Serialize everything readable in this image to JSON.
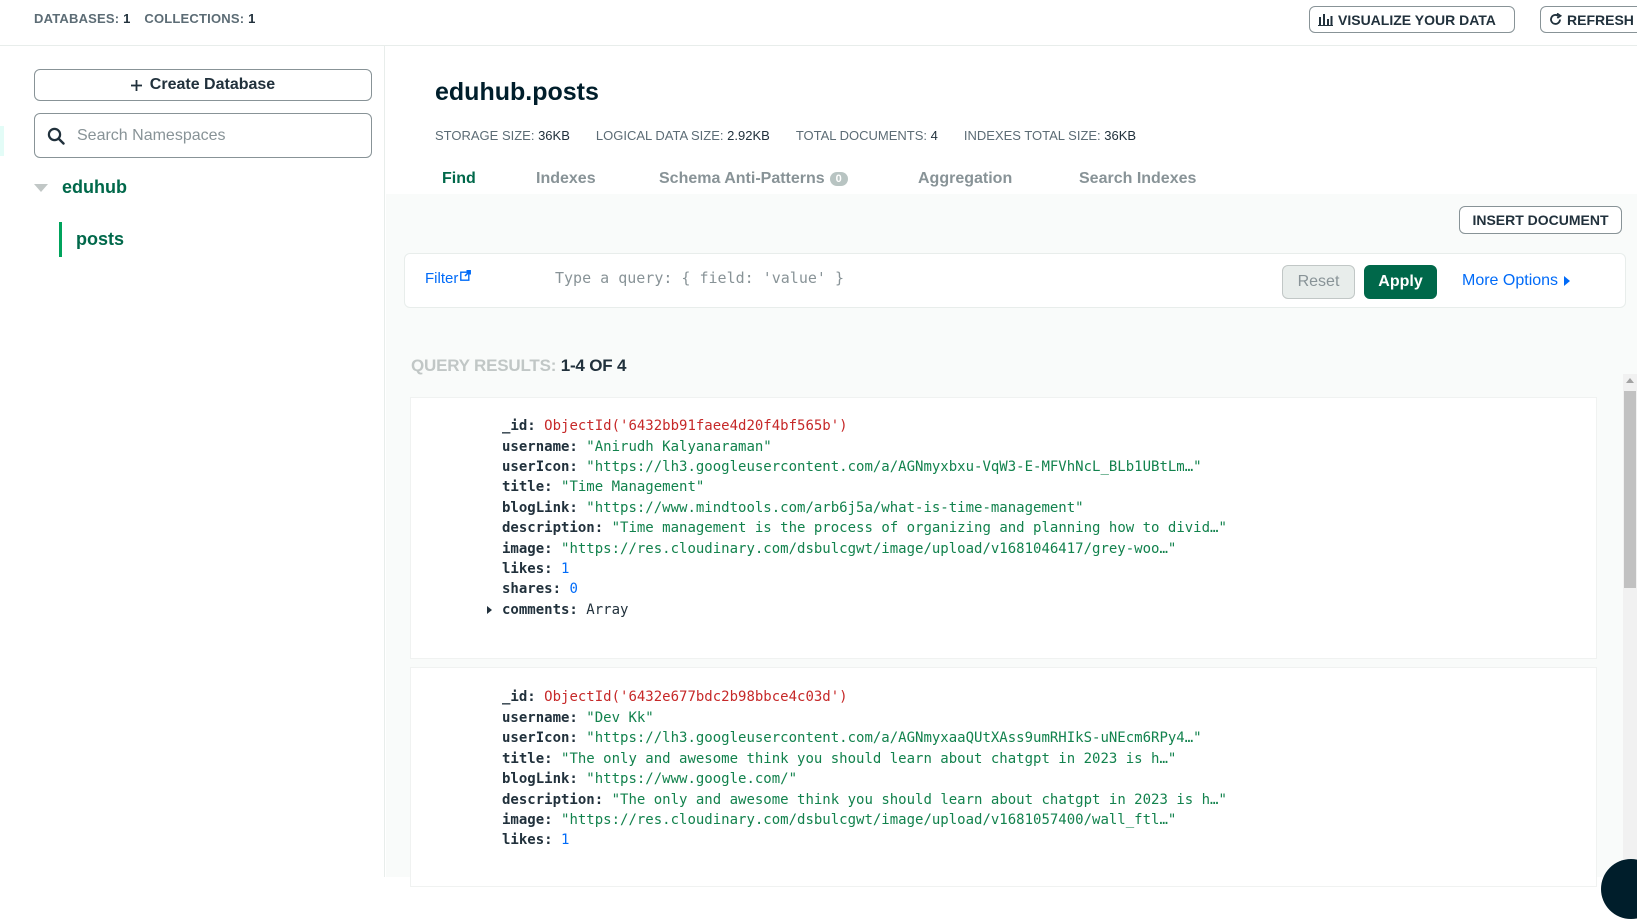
{
  "topbar": {
    "databases_label": "DATABASES:",
    "databases_count": "1",
    "collections_label": "COLLECTIONS:",
    "collections_count": "1",
    "visualize_label": "VISUALIZE YOUR DATA",
    "refresh_label": "REFRESH"
  },
  "sidebar": {
    "create_db_label": "Create Database",
    "search_placeholder": "Search Namespaces",
    "database_name": "eduhub",
    "collection_name": "posts"
  },
  "collection": {
    "title": "eduhub.posts",
    "stats": [
      {
        "label": "STORAGE SIZE:",
        "value": "36KB"
      },
      {
        "label": "LOGICAL DATA SIZE:",
        "value": "2.92KB"
      },
      {
        "label": "TOTAL DOCUMENTS:",
        "value": "4"
      },
      {
        "label": "INDEXES TOTAL SIZE:",
        "value": "36KB"
      }
    ]
  },
  "tabs": [
    {
      "label": "Find",
      "active": true
    },
    {
      "label": "Indexes",
      "active": false
    },
    {
      "label": "Schema Anti-Patterns",
      "badge": "0",
      "active": false
    },
    {
      "label": "Aggregation",
      "active": false
    },
    {
      "label": "Search Indexes",
      "active": false
    }
  ],
  "toolbar": {
    "insert_label": "INSERT DOCUMENT",
    "filter_label": "Filter",
    "filter_placeholder": "Type a query: { field: 'value' }",
    "reset_label": "Reset",
    "apply_label": "Apply",
    "more_options_label": "More Options"
  },
  "results": {
    "label": "QUERY RESULTS:",
    "range": "1-4 OF 4"
  },
  "documents": [
    {
      "fields": [
        {
          "key": "_id:",
          "value": "ObjectId('6432bb91faee4d20f4bf565b')",
          "type": "objectid"
        },
        {
          "key": "username:",
          "value": "\"Anirudh Kalyanaraman\"",
          "type": "string"
        },
        {
          "key": "userIcon:",
          "value": "\"https://lh3.googleusercontent.com/a/AGNmyxbxu-VqW3-E-MFVhNcL_BLb1UBtLm…\"",
          "type": "string"
        },
        {
          "key": "title:",
          "value": "\"Time Management\"",
          "type": "string"
        },
        {
          "key": "blogLink:",
          "value": "\"https://www.mindtools.com/arb6j5a/what-is-time-management\"",
          "type": "string"
        },
        {
          "key": "description:",
          "value": "\"Time management is the process of organizing and planning how to divid…\"",
          "type": "string"
        },
        {
          "key": "image:",
          "value": "\"https://res.cloudinary.com/dsbulcgwt/image/upload/v1681046417/grey-woo…\"",
          "type": "string"
        },
        {
          "key": "likes:",
          "value": "1",
          "type": "number"
        },
        {
          "key": "shares:",
          "value": "0",
          "type": "number"
        },
        {
          "key": "comments:",
          "value": "Array",
          "type": "array"
        }
      ]
    },
    {
      "fields": [
        {
          "key": "_id:",
          "value": "ObjectId('6432e677bdc2b98bbce4c03d')",
          "type": "objectid"
        },
        {
          "key": "username:",
          "value": "\"Dev Kk\"",
          "type": "string"
        },
        {
          "key": "userIcon:",
          "value": "\"https://lh3.googleusercontent.com/a/AGNmyxaaQUtXAss9umRHIkS-uNEcm6RPy4…\"",
          "type": "string"
        },
        {
          "key": "title:",
          "value": "\"The only and awesome think you should learn about chatgpt in 2023 is h…\"",
          "type": "string"
        },
        {
          "key": "blogLink:",
          "value": "\"https://www.google.com/\"",
          "type": "string"
        },
        {
          "key": "description:",
          "value": "\"The only and awesome think you should learn about chatgpt in 2023 is h…\"",
          "type": "string"
        },
        {
          "key": "image:",
          "value": "\"https://res.cloudinary.com/dsbulcgwt/image/upload/v1681057400/wall_ftl…\"",
          "type": "string"
        },
        {
          "key": "likes:",
          "value": "1",
          "type": "number"
        }
      ]
    }
  ],
  "colors": {
    "brand_green": "#00684a",
    "accent_green": "#00a35c",
    "link_blue": "#016bf8",
    "objectid_red": "#c62828",
    "string_green": "#12824d"
  }
}
